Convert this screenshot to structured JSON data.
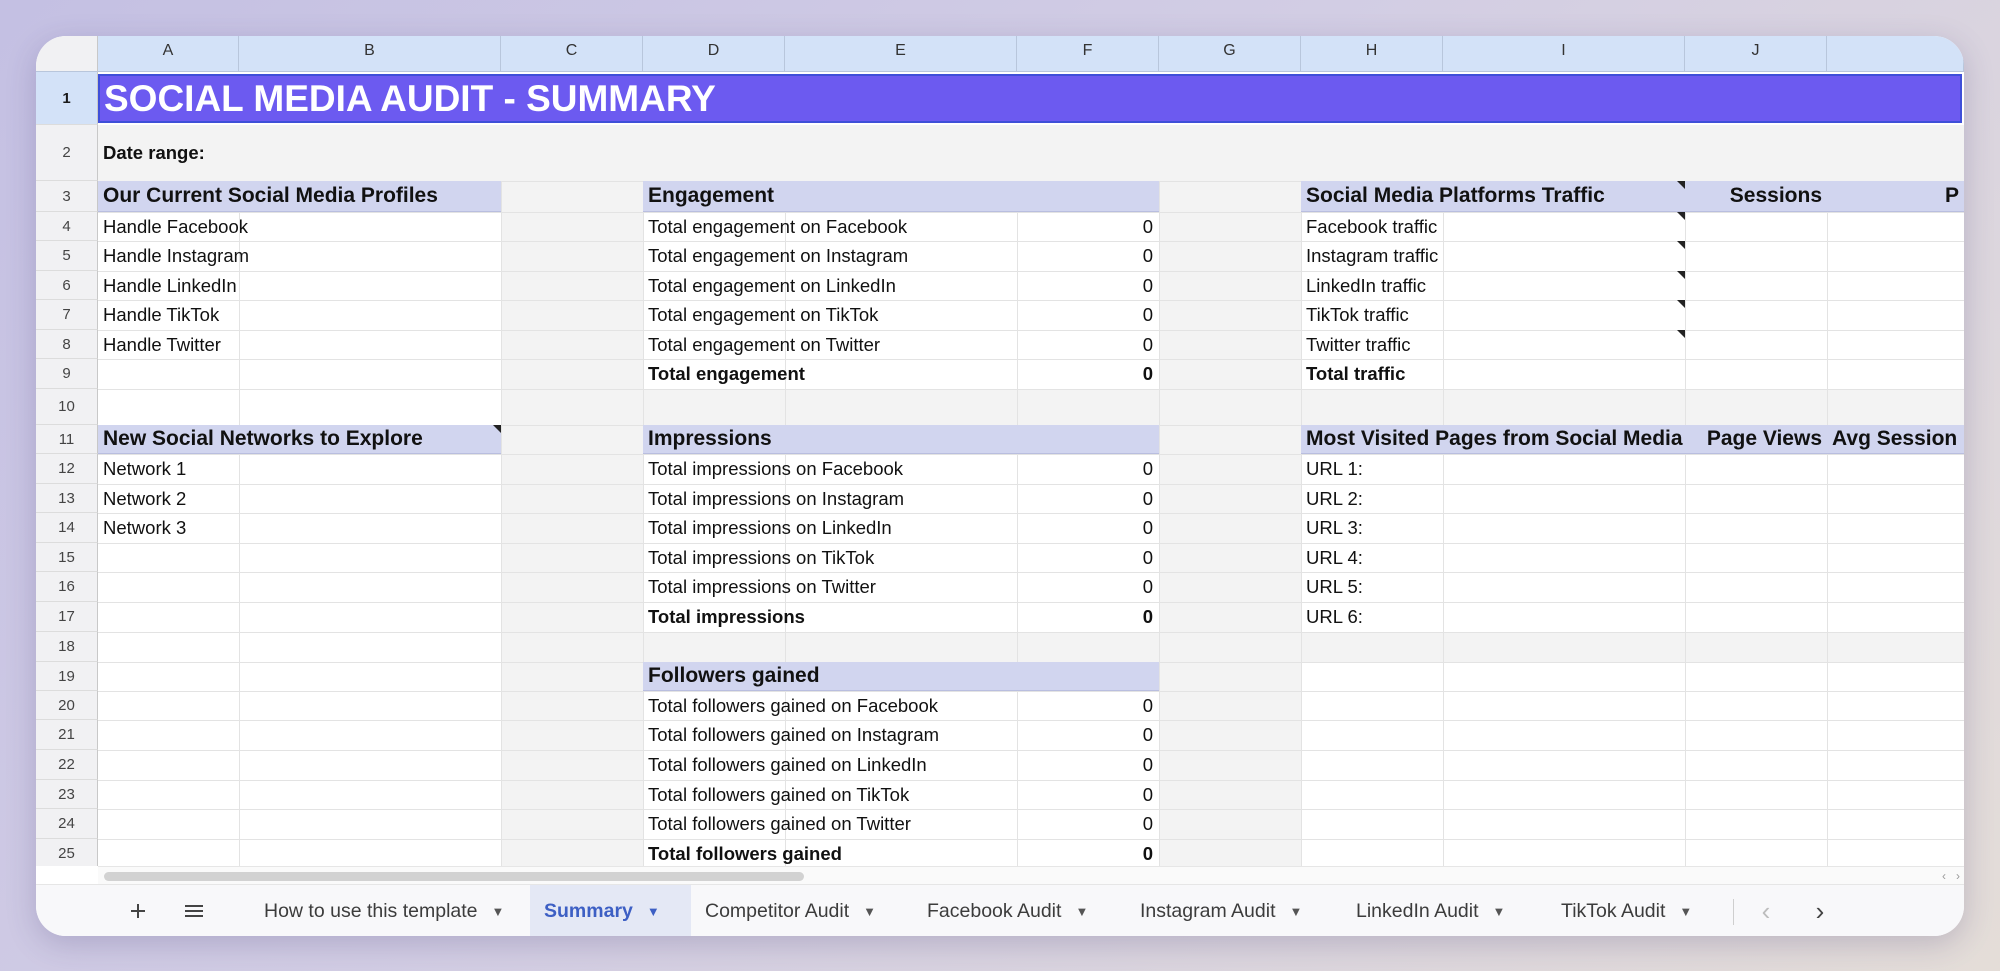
{
  "columns": [
    "A",
    "B",
    "C",
    "D",
    "E",
    "F",
    "G",
    "H",
    "I",
    "J"
  ],
  "rows": [
    "1",
    "2",
    "3",
    "4",
    "5",
    "6",
    "7",
    "8",
    "9",
    "10",
    "11",
    "12",
    "13",
    "14",
    "15",
    "16",
    "17",
    "18",
    "19",
    "20",
    "21",
    "22",
    "23",
    "24",
    "25"
  ],
  "title": "SOCIAL MEDIA AUDIT - SUMMARY",
  "date_range_label": "Date range:",
  "profiles": {
    "header": "Our Current Social Media Profiles",
    "items": [
      "Handle Facebook",
      "Handle Instagram",
      "Handle LinkedIn",
      "Handle TikTok",
      "Handle Twitter"
    ]
  },
  "new_networks": {
    "header": "New Social Networks to Explore",
    "items": [
      "Network 1",
      "Network 2",
      "Network 3"
    ]
  },
  "engagement": {
    "header": "Engagement",
    "rows": [
      {
        "label": "Total engagement on Facebook",
        "value": "0"
      },
      {
        "label": "Total engagement on Instagram",
        "value": "0"
      },
      {
        "label": "Total engagement on LinkedIn",
        "value": "0"
      },
      {
        "label": "Total engagement on TikTok",
        "value": "0"
      },
      {
        "label": "Total engagement on Twitter",
        "value": "0"
      }
    ],
    "total": {
      "label": "Total engagement",
      "value": "0"
    }
  },
  "impressions": {
    "header": "Impressions",
    "rows": [
      {
        "label": "Total impressions on Facebook",
        "value": "0"
      },
      {
        "label": "Total impressions on Instagram",
        "value": "0"
      },
      {
        "label": "Total impressions on LinkedIn",
        "value": "0"
      },
      {
        "label": "Total impressions on TikTok",
        "value": "0"
      },
      {
        "label": "Total impressions on Twitter",
        "value": "0"
      }
    ],
    "total": {
      "label": "Total impressions",
      "value": "0"
    }
  },
  "followers": {
    "header": "Followers gained",
    "rows": [
      {
        "label": "Total followers gained on Facebook",
        "value": "0"
      },
      {
        "label": "Total followers gained on Instagram",
        "value": "0"
      },
      {
        "label": "Total followers gained on LinkedIn",
        "value": "0"
      },
      {
        "label": "Total followers gained on TikTok",
        "value": "0"
      },
      {
        "label": "Total followers gained on Twitter",
        "value": "0"
      }
    ],
    "total": {
      "label": "Total followers gained",
      "value": "0"
    }
  },
  "traffic": {
    "header": "Social Media Platforms Traffic",
    "sessions_header": "Sessions",
    "next_header": "P",
    "rows": [
      "Facebook traffic",
      "Instagram traffic",
      "LinkedIn traffic",
      "TikTok traffic",
      "Twitter traffic"
    ],
    "total": "Total traffic"
  },
  "pages": {
    "header": "Most Visited Pages from Social Media",
    "page_views_header": "Page Views",
    "avg_session_header": "Avg Session D",
    "urls": [
      "URL 1:",
      "URL 2:",
      "URL 3:",
      "URL 4:",
      "URL 5:",
      "URL 6:"
    ]
  },
  "tabs": [
    "How to use this template",
    "Summary",
    "Competitor Audit",
    "Facebook Audit",
    "Instagram Audit",
    "LinkedIn Audit",
    "TikTok Audit"
  ],
  "active_tab": "Summary",
  "icons": {
    "add": "plus-icon",
    "all_sheets": "menu-icon",
    "prev": "chevron-left-icon",
    "next": "chevron-right-icon"
  }
}
